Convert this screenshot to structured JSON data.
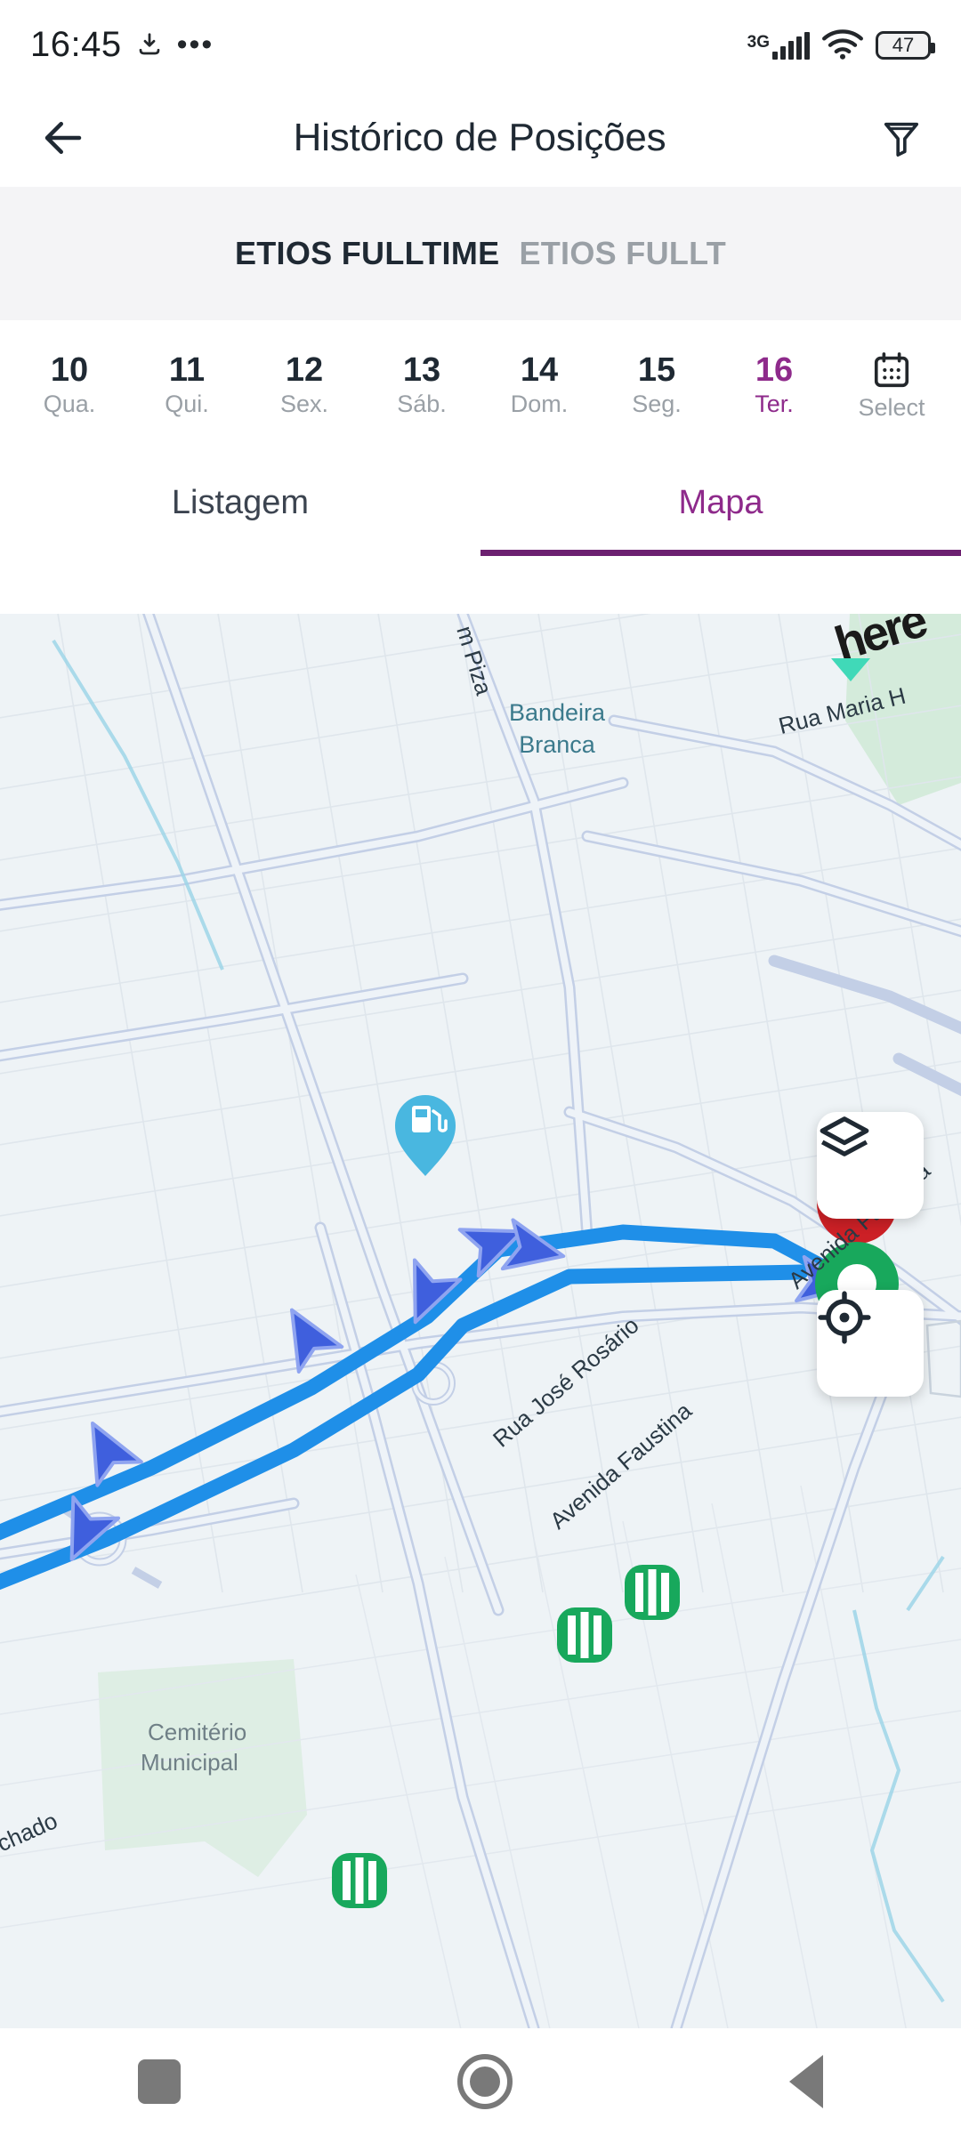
{
  "status_bar": {
    "time": "16:45",
    "download_icon": "download-icon",
    "overflow_icon": "more-dots-icon",
    "network_type": "3G",
    "signal_icon": "signal-bars-icon",
    "wifi_icon": "wifi-icon",
    "battery_level": "47"
  },
  "app_bar": {
    "back_icon": "back-arrow-icon",
    "title": "Histórico de Posições",
    "filter_icon": "filter-funnel-icon"
  },
  "vehicle_bar": {
    "active_vehicle": "ETIOS FULLTIME",
    "next_vehicle": "ETIOS FULLT"
  },
  "date_selector": {
    "days": [
      {
        "num": "10",
        "label": "Qua.",
        "selected": false
      },
      {
        "num": "11",
        "label": "Qui.",
        "selected": false
      },
      {
        "num": "12",
        "label": "Sex.",
        "selected": false
      },
      {
        "num": "13",
        "label": "Sáb.",
        "selected": false
      },
      {
        "num": "14",
        "label": "Dom.",
        "selected": false
      },
      {
        "num": "15",
        "label": "Seg.",
        "selected": false
      },
      {
        "num": "16",
        "label": "Ter.",
        "selected": true
      }
    ],
    "select_label": "Select",
    "calendar_icon": "calendar-icon"
  },
  "tabs": [
    {
      "label": "Listagem",
      "active": false
    },
    {
      "label": "Mapa",
      "active": true
    }
  ],
  "map": {
    "provider_logo": "here",
    "labels": [
      {
        "text": "m Piza",
        "kind": "street"
      },
      {
        "text": "Bandeira",
        "kind": "place"
      },
      {
        "text": "Branca",
        "kind": "place"
      },
      {
        "text": "Rua Maria H",
        "kind": "street"
      },
      {
        "text": "Rua José Rosário",
        "kind": "street"
      },
      {
        "text": "Avenida Faustina",
        "kind": "street"
      },
      {
        "text": "Avenida Faustina",
        "kind": "street"
      },
      {
        "text": "chado",
        "kind": "street"
      },
      {
        "text": "Cemitério",
        "kind": "area"
      },
      {
        "text": "Municipal",
        "kind": "area"
      }
    ],
    "pois": [
      {
        "name": "gas-station-pin",
        "label": "Bandeira Branca"
      }
    ],
    "route": {
      "line_color": "#1f8fe8",
      "arrow_color": "#3f5fdd",
      "stop_marker_color": "#18a85c",
      "start_marker_color": "#2f4fd8",
      "end_marker_color": "#d82b2b",
      "direction_arrows": 6,
      "stop_markers": 3
    },
    "controls": [
      {
        "name": "map-layers-button",
        "icon": "layers-icon"
      },
      {
        "name": "my-location-button",
        "icon": "crosshair-location-icon"
      }
    ]
  },
  "nav_bar": {
    "recents_icon": "recents-square-icon",
    "home_icon": "home-circle-icon",
    "back_icon": "back-triangle-icon"
  },
  "colors": {
    "accent_purple": "#8e2a8b",
    "tab_underline": "#6c2070",
    "text_dark": "#1f2933",
    "text_muted": "#9aa0a6",
    "vehicle_bar_bg": "#f4f4f6",
    "map_bg": "#eef3f6"
  }
}
